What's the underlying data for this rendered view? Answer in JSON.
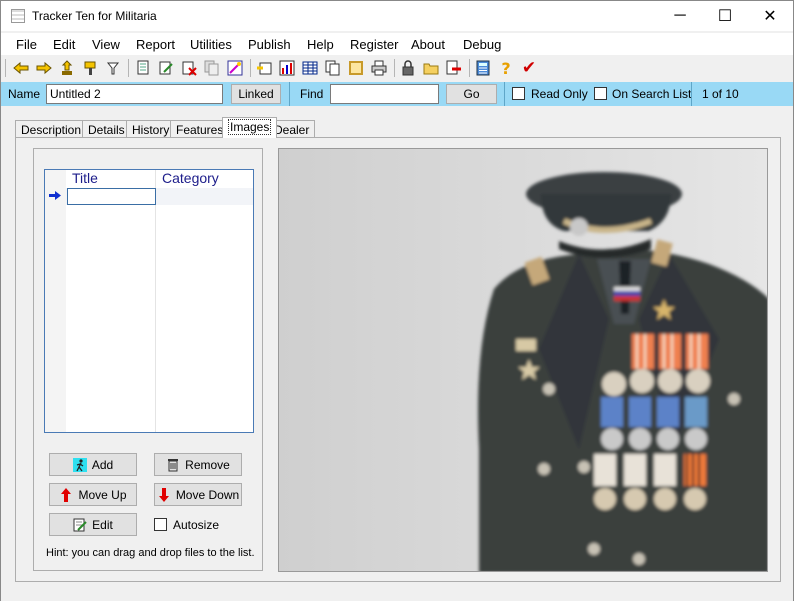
{
  "window": {
    "title": "Tracker Ten for Militaria",
    "minimize": "─",
    "maximize": "☐",
    "close": "✕"
  },
  "menu": [
    "File",
    "Edit",
    "View",
    "Report",
    "Utilities",
    "Publish",
    "Help",
    "Register",
    "About",
    "Debug"
  ],
  "toolbar": {
    "icons": [
      "arrow-left-icon",
      "arrow-right-icon",
      "lift-icon",
      "paint-icon",
      "filter-icon",
      "document-icon",
      "edit-doc-icon",
      "delete-doc-icon",
      "copy-doc-icon",
      "magic-icon",
      "import-icon",
      "chart-icon",
      "table-icon",
      "pages-icon",
      "frame-icon",
      "print-icon",
      "lock-icon",
      "folder-icon",
      "export-icon",
      "calculator-icon",
      "help-icon",
      "check-icon"
    ]
  },
  "searchbar": {
    "name_label": "Name",
    "name_value": "Untitled 2",
    "linked_button": "Linked",
    "find_label": "Find",
    "find_value": "",
    "go_button": "Go",
    "read_only_label": "Read Only",
    "on_search_list_label": "On Search List",
    "record_position": "1 of 10"
  },
  "tabs": [
    "Description",
    "Details",
    "History",
    "Features",
    "Images",
    "Dealer"
  ],
  "active_tab": "Images",
  "images_panel": {
    "columns": [
      "Title",
      "Category"
    ],
    "rows": [
      {
        "title": "",
        "category": ""
      }
    ],
    "buttons": {
      "add": "Add",
      "remove": "Remove",
      "move_up": "Move Up",
      "move_down": "Move Down",
      "edit": "Edit"
    },
    "autosize_label": "Autosize",
    "hint": "Hint: you can drag and drop files to the list."
  },
  "colors": {
    "searchbar_bg": "#99d9f5",
    "grid_header_text": "#1c1c8a",
    "grid_border": "#4a7ab5"
  }
}
